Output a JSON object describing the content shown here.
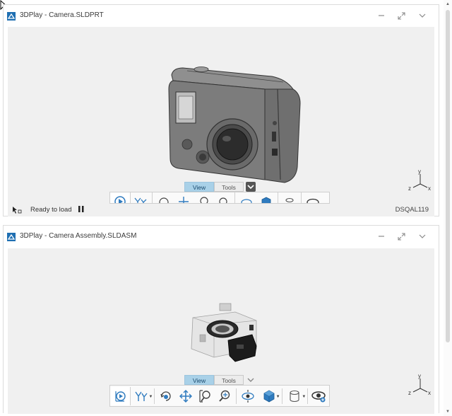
{
  "panels": [
    {
      "title": "3DPlay - Camera.SLDPRT",
      "status_text": "Ready to load",
      "user": "DSQAL119",
      "tabs": [
        "View",
        "Tools"
      ],
      "triad": {
        "y": "y",
        "z": "z",
        "x": "x"
      }
    },
    {
      "title": "3DPlay - Camera Assembly.SLDASM",
      "tabs": [
        "View",
        "Tools"
      ],
      "triad": {
        "y": "y",
        "z": "z",
        "x": "x"
      }
    }
  ],
  "icons": {
    "window": [
      "minimize-icon",
      "maximize-icon",
      "chevron-down-icon"
    ],
    "toolbar": [
      "play-icon",
      "tree-icon",
      "rotate-view-icon",
      "pan-icon",
      "zoom-area-icon",
      "zoom-icon",
      "eye-orbit-icon",
      "cube-view-icon",
      "section-icon",
      "visibility-icon"
    ]
  },
  "colors": {
    "tab_active": "#a9d1e8",
    "viewport_bg": "#f0f0f0",
    "cube_blue": "#2f7bbf"
  }
}
